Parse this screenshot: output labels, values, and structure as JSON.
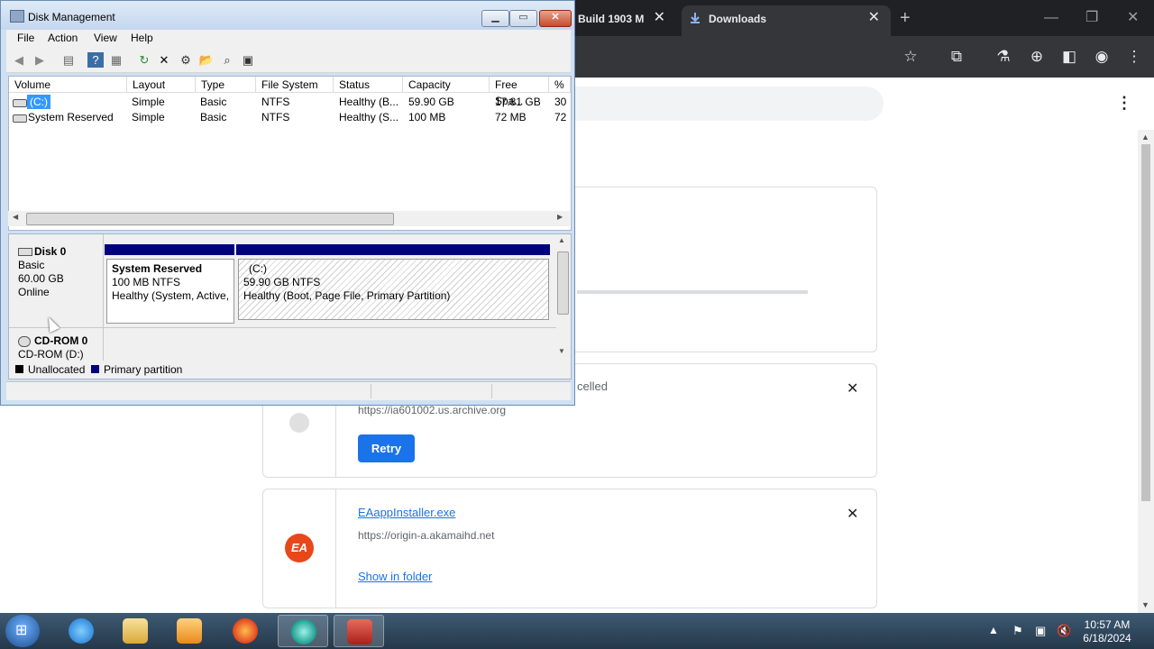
{
  "chrome": {
    "tabs": [
      {
        "label": "Build 1903 M",
        "close": "✕"
      },
      {
        "label": "Downloads",
        "close": "✕"
      }
    ],
    "new_tab": "+",
    "window_controls": {
      "minimize": "—",
      "restore": "❐",
      "close": "✕"
    },
    "toolbar_icons": [
      "star-icon",
      "extensions-icon",
      "labs-icon",
      "download-icon",
      "sidebar-icon",
      "profile-icon",
      "menu-icon"
    ]
  },
  "downloads": {
    "cards": [
      {
        "status": "celled",
        "url": "https://ia601002.us.archive.org",
        "action": "Retry"
      },
      {
        "filename": "EAappInstaller.exe",
        "url": "https://origin-a.akamaihd.net",
        "action": "Show in folder",
        "icon_text": "EA"
      }
    ]
  },
  "disk_management": {
    "title": "Disk Management",
    "menu": [
      "File",
      "Action",
      "View",
      "Help"
    ],
    "columns": [
      "Volume",
      "Layout",
      "Type",
      "File System",
      "Status",
      "Capacity",
      "Free Spa...",
      "% F"
    ],
    "rows": [
      {
        "volume": "(C:)",
        "layout": "Simple",
        "type": "Basic",
        "fs": "NTFS",
        "status": "Healthy (B...",
        "capacity": "59.90 GB",
        "free": "17.81 GB",
        "pct": "30"
      },
      {
        "volume": "System Reserved",
        "layout": "Simple",
        "type": "Basic",
        "fs": "NTFS",
        "status": "Healthy (S...",
        "capacity": "100 MB",
        "free": "72 MB",
        "pct": "72"
      }
    ],
    "disk0": {
      "name": "Disk 0",
      "kind": "Basic",
      "size": "60.00 GB",
      "state": "Online",
      "partitions": [
        {
          "name": "System Reserved",
          "size": "100 MB NTFS",
          "status": "Healthy (System, Active,"
        },
        {
          "name": "(C:)",
          "size": "59.90 GB NTFS",
          "status": "Healthy (Boot, Page File, Primary Partition)"
        }
      ]
    },
    "cdrom": {
      "name": "CD-ROM 0",
      "drive": "CD-ROM (D:)"
    },
    "legend": [
      "Unallocated",
      "Primary partition"
    ],
    "colors": {
      "unallocated": "#000000",
      "primary": "#00007f"
    }
  },
  "taskbar": {
    "apps": [
      "internet-explorer",
      "file-explorer",
      "media-player",
      "firefox",
      "chrome-app",
      "toolbox"
    ],
    "time": "10:57 AM",
    "date": "6/18/2024"
  }
}
